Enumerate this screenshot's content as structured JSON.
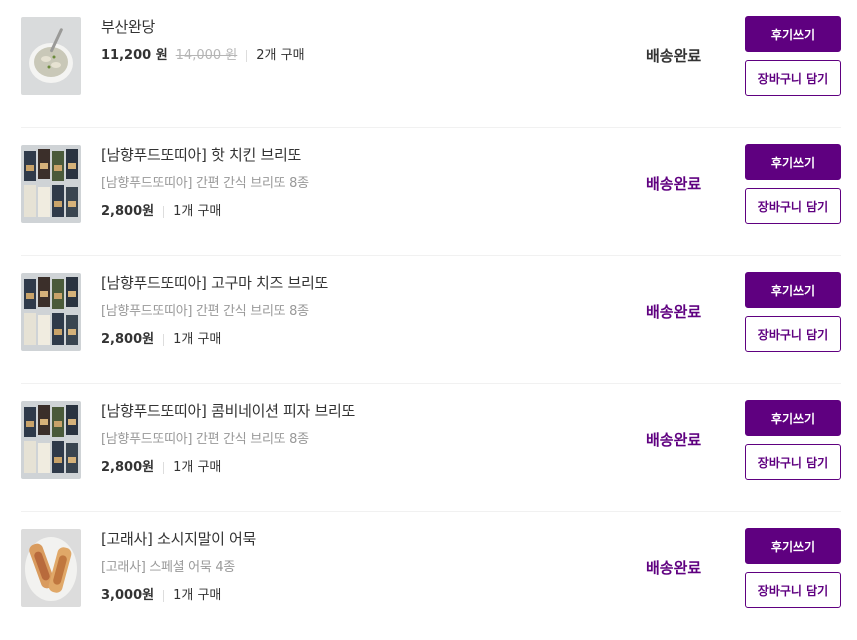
{
  "colors": {
    "accent": "#5f0080",
    "text": "#333333",
    "muted": "#999999"
  },
  "orders": [
    {
      "image_icon": "soup-bowl-photo",
      "name": "부산완당",
      "option": "",
      "price": "11,200 원",
      "original_price": "14,000 원",
      "quantity": "2개 구매",
      "status": "배송완료",
      "review_label": "후기쓰기",
      "cart_label": "장바구니 담기"
    },
    {
      "image_icon": "burrito-pack-photo",
      "name": "[남향푸드또띠아] 핫 치킨 브리또",
      "option": "[남향푸드또띠아] 간편 간식 브리또 8종",
      "price": "2,800원",
      "original_price": "",
      "quantity": "1개 구매",
      "status": "배송완료",
      "review_label": "후기쓰기",
      "cart_label": "장바구니 담기"
    },
    {
      "image_icon": "burrito-pack-photo",
      "name": "[남향푸드또띠아] 고구마 치즈 브리또",
      "option": "[남향푸드또띠아] 간편 간식 브리또 8종",
      "price": "2,800원",
      "original_price": "",
      "quantity": "1개 구매",
      "status": "배송완료",
      "review_label": "후기쓰기",
      "cart_label": "장바구니 담기"
    },
    {
      "image_icon": "burrito-pack-photo",
      "name": "[남향푸드또띠아] 콤비네이션 피자 브리또",
      "option": "[남향푸드또띠아] 간편 간식 브리또 8종",
      "price": "2,800원",
      "original_price": "",
      "quantity": "1개 구매",
      "status": "배송완료",
      "review_label": "후기쓰기",
      "cart_label": "장바구니 담기"
    },
    {
      "image_icon": "fishcake-photo",
      "name": "[고래사] 소시지말이 어묵",
      "option": "[고래사] 스페셜 어묵 4종",
      "price": "3,000원",
      "original_price": "",
      "quantity": "1개 구매",
      "status": "배송완료",
      "review_label": "후기쓰기",
      "cart_label": "장바구니 담기"
    }
  ]
}
